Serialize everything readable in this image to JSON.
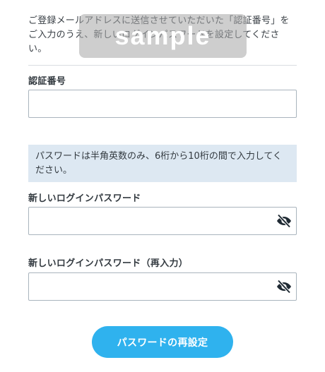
{
  "intro": {
    "text": "ご登録メールアドレスに送信させていただいた「認証番号」をご入力のうえ、新しいログインパスワードを設定してください。"
  },
  "watermark": {
    "text": "sample"
  },
  "auth_code": {
    "label": "認証番号",
    "value": ""
  },
  "notice": {
    "text": "パスワードは半角英数のみ、6桁から10桁の間で入力してください。"
  },
  "new_password": {
    "label": "新しいログインパスワード",
    "value": "",
    "toggle_icon": "eye-slash-icon"
  },
  "confirm_password": {
    "label": "新しいログインパスワード（再入力）",
    "value": "",
    "toggle_icon": "eye-slash-icon"
  },
  "submit": {
    "label": "パスワードの再設定",
    "color": "#2fb2ee"
  }
}
